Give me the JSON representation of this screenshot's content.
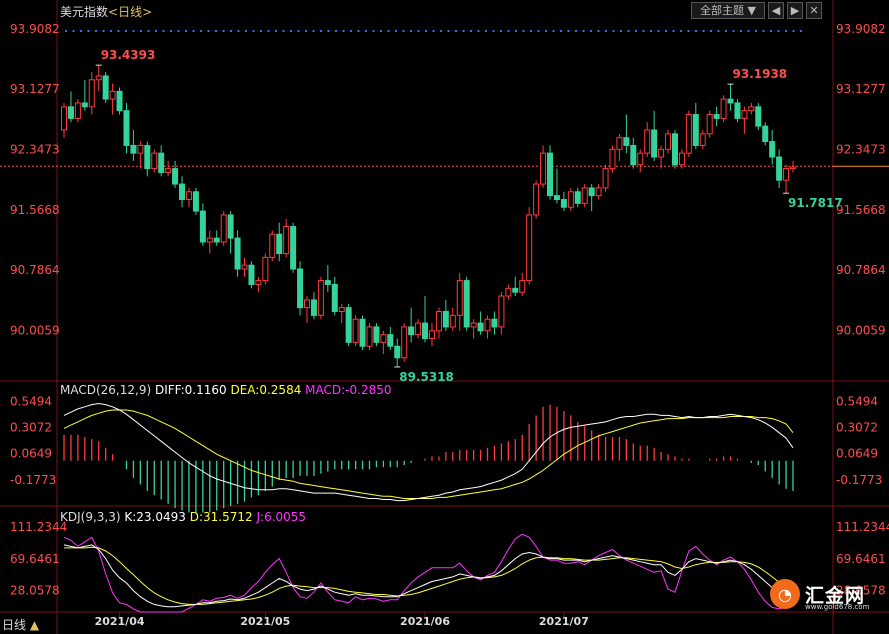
{
  "header": {
    "title": "美元指数",
    "period_label": "<日线>",
    "theme_button": "全部主题",
    "theme_arrow": "▼"
  },
  "window_controls": [
    "◀",
    "▶",
    "✕"
  ],
  "footer": {
    "tab_label": "日线",
    "tab_arrow": "▲"
  },
  "logo": {
    "text": "汇金网",
    "url": "www.gold678.com"
  },
  "colors": {
    "up": "#ff3b3b",
    "down": "#35d39c",
    "axis": "#ff4d4d",
    "dif": "#ffffff",
    "dea": "#ffff33",
    "macd_text": "#ff33ff",
    "j": "#ff33ff",
    "reference": "#ff8c1a"
  },
  "chart_data": [
    {
      "type": "candlestick",
      "title": "美元指数",
      "y_ticks": [
        "93.9082",
        "93.1277",
        "92.3473",
        "91.5668",
        "90.7864",
        "90.0059"
      ],
      "x_ticks": [
        "2021/04",
        "2021/05",
        "2021/06",
        "2021/07"
      ],
      "ylim": [
        89.35,
        94.05
      ],
      "reference_line": 92.13,
      "annotations": [
        {
          "text": "93.4393",
          "value": 93.4393,
          "color": "#ff4d4d"
        },
        {
          "text": "89.5318",
          "value": 89.5318,
          "color": "#35d39c"
        },
        {
          "text": "93.1938",
          "value": 93.1938,
          "color": "#ff4d4d"
        },
        {
          "text": "91.7817",
          "value": 91.7817,
          "color": "#35d39c"
        }
      ],
      "candles": [
        [
          92.6,
          92.95,
          92.5,
          92.9
        ],
        [
          92.9,
          93.1,
          92.7,
          92.75
        ],
        [
          92.75,
          93.0,
          92.7,
          92.95
        ],
        [
          92.95,
          93.25,
          92.85,
          92.9
        ],
        [
          92.9,
          93.35,
          92.8,
          93.25
        ],
        [
          93.25,
          93.4393,
          93.1,
          93.3
        ],
        [
          93.3,
          93.35,
          92.95,
          93.0
        ],
        [
          93.0,
          93.2,
          92.8,
          93.1
        ],
        [
          93.1,
          93.15,
          92.8,
          92.85
        ],
        [
          92.85,
          92.95,
          92.3,
          92.4
        ],
        [
          92.4,
          92.6,
          92.2,
          92.3
        ],
        [
          92.3,
          92.45,
          92.1,
          92.4
        ],
        [
          92.4,
          92.45,
          92.0,
          92.1
        ],
        [
          92.1,
          92.35,
          92.05,
          92.3
        ],
        [
          92.3,
          92.4,
          92.0,
          92.05
        ],
        [
          92.05,
          92.2,
          92.0,
          92.1
        ],
        [
          92.1,
          92.2,
          91.85,
          91.9
        ],
        [
          91.9,
          92.0,
          91.6,
          91.7
        ],
        [
          91.7,
          91.85,
          91.6,
          91.8
        ],
        [
          91.8,
          91.85,
          91.5,
          91.55
        ],
        [
          91.55,
          91.65,
          91.1,
          91.15
        ],
        [
          91.15,
          91.3,
          91.0,
          91.2
        ],
        [
          91.2,
          91.3,
          91.1,
          91.15
        ],
        [
          91.15,
          91.55,
          91.1,
          91.5
        ],
        [
          91.5,
          91.55,
          91.0,
          91.2
        ],
        [
          91.2,
          91.3,
          90.7,
          90.8
        ],
        [
          90.8,
          90.95,
          90.7,
          90.85
        ],
        [
          90.85,
          90.9,
          90.55,
          90.6
        ],
        [
          90.6,
          90.7,
          90.5,
          90.65
        ],
        [
          90.65,
          91.0,
          90.6,
          90.95
        ],
        [
          90.95,
          91.3,
          90.9,
          91.25
        ],
        [
          91.25,
          91.4,
          90.9,
          91.0
        ],
        [
          91.0,
          91.45,
          90.95,
          91.35
        ],
        [
          91.35,
          91.4,
          90.75,
          90.8
        ],
        [
          90.8,
          90.9,
          90.2,
          90.3
        ],
        [
          90.3,
          90.45,
          90.1,
          90.4
        ],
        [
          90.4,
          90.5,
          90.15,
          90.2
        ],
        [
          90.2,
          90.7,
          90.15,
          90.65
        ],
        [
          90.65,
          90.85,
          90.5,
          90.6
        ],
        [
          90.6,
          90.7,
          90.2,
          90.25
        ],
        [
          90.25,
          90.35,
          90.1,
          90.3
        ],
        [
          90.3,
          90.35,
          89.8,
          89.85
        ],
        [
          89.85,
          90.2,
          89.8,
          90.15
        ],
        [
          90.15,
          90.2,
          89.75,
          89.8
        ],
        [
          89.8,
          90.1,
          89.75,
          90.05
        ],
        [
          90.05,
          90.1,
          89.8,
          89.85
        ],
        [
          89.85,
          90.0,
          89.7,
          89.95
        ],
        [
          89.95,
          90.05,
          89.75,
          89.8
        ],
        [
          89.8,
          89.9,
          89.5318,
          89.65
        ],
        [
          89.65,
          90.1,
          89.6,
          90.05
        ],
        [
          90.05,
          90.3,
          89.85,
          89.95
        ],
        [
          89.95,
          90.15,
          89.9,
          90.1
        ],
        [
          90.1,
          90.45,
          89.85,
          89.9
        ],
        [
          89.9,
          90.1,
          89.8,
          90.0
        ],
        [
          90.0,
          90.3,
          89.9,
          90.25
        ],
        [
          90.25,
          90.4,
          90.0,
          90.05
        ],
        [
          90.05,
          90.3,
          90.0,
          90.2
        ],
        [
          90.2,
          90.75,
          90.0,
          90.65
        ],
        [
          90.65,
          90.7,
          90.0,
          90.05
        ],
        [
          90.05,
          90.15,
          89.9,
          90.1
        ],
        [
          90.1,
          90.25,
          89.95,
          90.0
        ],
        [
          90.0,
          90.2,
          89.9,
          90.15
        ],
        [
          90.15,
          90.25,
          89.95,
          90.05
        ],
        [
          90.05,
          90.5,
          89.95,
          90.45
        ],
        [
          90.45,
          90.6,
          90.4,
          90.55
        ],
        [
          90.55,
          90.7,
          90.45,
          90.5
        ],
        [
          90.5,
          90.75,
          90.45,
          90.65
        ],
        [
          90.65,
          91.6,
          90.6,
          91.5
        ],
        [
          91.5,
          91.95,
          91.45,
          91.9
        ],
        [
          91.9,
          92.4,
          91.85,
          92.3
        ],
        [
          92.3,
          92.4,
          91.7,
          91.75
        ],
        [
          91.75,
          92.1,
          91.65,
          91.7
        ],
        [
          91.7,
          91.8,
          91.55,
          91.6
        ],
        [
          91.6,
          91.85,
          91.55,
          91.8
        ],
        [
          91.8,
          91.85,
          91.6,
          91.65
        ],
        [
          91.65,
          91.9,
          91.6,
          91.85
        ],
        [
          91.85,
          91.9,
          91.55,
          91.75
        ],
        [
          91.75,
          91.9,
          91.7,
          91.85
        ],
        [
          91.85,
          92.15,
          91.8,
          92.1
        ],
        [
          92.1,
          92.4,
          92.05,
          92.35
        ],
        [
          92.35,
          92.55,
          92.2,
          92.5
        ],
        [
          92.5,
          92.8,
          92.3,
          92.4
        ],
        [
          92.4,
          92.5,
          92.1,
          92.15
        ],
        [
          92.15,
          92.35,
          92.05,
          92.3
        ],
        [
          92.3,
          92.7,
          92.25,
          92.6
        ],
        [
          92.6,
          92.85,
          92.2,
          92.25
        ],
        [
          92.25,
          92.4,
          92.1,
          92.35
        ],
        [
          92.35,
          92.6,
          92.3,
          92.55
        ],
        [
          92.55,
          92.6,
          92.1,
          92.15
        ],
        [
          92.15,
          92.35,
          92.1,
          92.3
        ],
        [
          92.3,
          92.85,
          92.25,
          92.8
        ],
        [
          92.8,
          92.95,
          92.35,
          92.4
        ],
        [
          92.4,
          92.6,
          92.35,
          92.55
        ],
        [
          92.55,
          92.85,
          92.5,
          92.8
        ],
        [
          92.8,
          92.9,
          92.65,
          92.75
        ],
        [
          92.75,
          93.05,
          92.7,
          93.0
        ],
        [
          93.0,
          93.1938,
          92.85,
          92.95
        ],
        [
          92.95,
          93.0,
          92.7,
          92.75
        ],
        [
          92.75,
          92.9,
          92.55,
          92.85
        ],
        [
          92.85,
          92.95,
          92.8,
          92.9
        ],
        [
          92.9,
          92.95,
          92.6,
          92.65
        ],
        [
          92.65,
          92.7,
          92.4,
          92.45
        ],
        [
          92.45,
          92.6,
          92.15,
          92.25
        ],
        [
          92.25,
          92.35,
          91.85,
          91.95
        ],
        [
          91.95,
          92.15,
          91.7817,
          92.1
        ],
        [
          92.1,
          92.2,
          92.05,
          92.12
        ]
      ]
    },
    {
      "type": "macd",
      "title": "MACD(26,12,9)",
      "readouts": {
        "dif": "DIFF:0.1160",
        "dea": "DEA:0.2584",
        "macd": "MACD:-0.2850"
      },
      "y_ticks": [
        "0.5494",
        "0.3072",
        "0.0649",
        "-0.1773"
      ],
      "ylim": [
        -0.42,
        0.6
      ],
      "dif": [
        0.42,
        0.45,
        0.48,
        0.5,
        0.52,
        0.53,
        0.52,
        0.5,
        0.47,
        0.43,
        0.38,
        0.33,
        0.28,
        0.23,
        0.18,
        0.13,
        0.08,
        0.03,
        -0.02,
        -0.06,
        -0.1,
        -0.14,
        -0.17,
        -0.19,
        -0.21,
        -0.23,
        -0.25,
        -0.26,
        -0.27,
        -0.27,
        -0.27,
        -0.26,
        -0.26,
        -0.27,
        -0.28,
        -0.29,
        -0.3,
        -0.3,
        -0.3,
        -0.3,
        -0.31,
        -0.32,
        -0.33,
        -0.34,
        -0.35,
        -0.35,
        -0.36,
        -0.36,
        -0.37,
        -0.37,
        -0.36,
        -0.35,
        -0.34,
        -0.33,
        -0.32,
        -0.3,
        -0.29,
        -0.27,
        -0.26,
        -0.25,
        -0.24,
        -0.22,
        -0.2,
        -0.18,
        -0.15,
        -0.12,
        -0.08,
        0.0,
        0.08,
        0.16,
        0.22,
        0.26,
        0.29,
        0.31,
        0.32,
        0.33,
        0.34,
        0.35,
        0.36,
        0.38,
        0.4,
        0.41,
        0.41,
        0.42,
        0.43,
        0.43,
        0.42,
        0.42,
        0.41,
        0.4,
        0.41,
        0.4,
        0.4,
        0.41,
        0.41,
        0.42,
        0.43,
        0.42,
        0.41,
        0.4,
        0.38,
        0.35,
        0.31,
        0.26,
        0.21,
        0.12
      ],
      "dea": [
        0.3,
        0.33,
        0.36,
        0.39,
        0.42,
        0.44,
        0.46,
        0.47,
        0.47,
        0.47,
        0.46,
        0.44,
        0.42,
        0.39,
        0.36,
        0.33,
        0.3,
        0.26,
        0.22,
        0.18,
        0.14,
        0.1,
        0.06,
        0.03,
        0.0,
        -0.03,
        -0.06,
        -0.09,
        -0.11,
        -0.13,
        -0.15,
        -0.17,
        -0.18,
        -0.19,
        -0.21,
        -0.22,
        -0.23,
        -0.24,
        -0.25,
        -0.26,
        -0.27,
        -0.28,
        -0.29,
        -0.3,
        -0.31,
        -0.32,
        -0.33,
        -0.33,
        -0.34,
        -0.35,
        -0.35,
        -0.35,
        -0.35,
        -0.35,
        -0.34,
        -0.34,
        -0.33,
        -0.32,
        -0.31,
        -0.3,
        -0.29,
        -0.28,
        -0.27,
        -0.26,
        -0.24,
        -0.22,
        -0.2,
        -0.17,
        -0.13,
        -0.09,
        -0.04,
        0.01,
        0.06,
        0.1,
        0.14,
        0.17,
        0.2,
        0.23,
        0.25,
        0.27,
        0.29,
        0.31,
        0.33,
        0.35,
        0.36,
        0.37,
        0.38,
        0.39,
        0.39,
        0.39,
        0.4,
        0.4,
        0.4,
        0.4,
        0.4,
        0.4,
        0.41,
        0.41,
        0.41,
        0.41,
        0.4,
        0.4,
        0.39,
        0.37,
        0.34,
        0.26
      ]
    },
    {
      "type": "kdj",
      "title": "KDJ(9,3,3)",
      "readouts": {
        "k": "K:23.0493",
        "d": "D:31.5712",
        "j": "J:6.0055"
      },
      "y_ticks": [
        "111.2344",
        "69.6461",
        "28.0578"
      ],
      "ylim": [
        0,
        118
      ],
      "k": [
        88,
        86,
        84,
        86,
        88,
        82,
        70,
        55,
        45,
        38,
        28,
        20,
        14,
        10,
        8,
        7,
        7,
        8,
        9,
        10,
        12,
        12,
        14,
        15,
        17,
        16,
        18,
        22,
        26,
        32,
        38,
        44,
        40,
        34,
        30,
        28,
        30,
        34,
        30,
        26,
        24,
        22,
        24,
        22,
        22,
        21,
        20,
        20,
        20,
        24,
        28,
        32,
        36,
        40,
        42,
        44,
        46,
        50,
        48,
        46,
        44,
        46,
        48,
        54,
        62,
        70,
        76,
        78,
        76,
        72,
        70,
        70,
        68,
        68,
        68,
        66,
        68,
        70,
        72,
        74,
        72,
        70,
        68,
        66,
        64,
        62,
        62,
        52,
        48,
        56,
        66,
        70,
        68,
        66,
        64,
        66,
        68,
        66,
        62,
        56,
        48,
        40,
        32,
        27,
        23
      ],
      "d": [
        84,
        84,
        84,
        84,
        85,
        84,
        80,
        74,
        66,
        57,
        49,
        40,
        32,
        25,
        20,
        16,
        13,
        11,
        10,
        10,
        10,
        11,
        12,
        13,
        14,
        15,
        16,
        17,
        19,
        22,
        26,
        31,
        34,
        35,
        34,
        33,
        32,
        32,
        32,
        31,
        29,
        27,
        26,
        25,
        24,
        23,
        23,
        22,
        21,
        22,
        23,
        25,
        28,
        31,
        34,
        37,
        40,
        43,
        45,
        46,
        45,
        45,
        46,
        48,
        52,
        57,
        63,
        68,
        71,
        72,
        71,
        71,
        70,
        70,
        69,
        68,
        68,
        68,
        69,
        70,
        71,
        71,
        70,
        69,
        68,
        67,
        66,
        63,
        59,
        57,
        59,
        62,
        64,
        65,
        65,
        65,
        66,
        66,
        65,
        63,
        59,
        53,
        46,
        39,
        33
      ],
      "j": [
        98,
        94,
        86,
        92,
        98,
        80,
        50,
        25,
        12,
        10,
        4,
        0,
        0,
        0,
        0,
        0,
        0,
        0,
        5,
        10,
        16,
        14,
        18,
        19,
        22,
        18,
        22,
        32,
        40,
        52,
        62,
        70,
        52,
        32,
        20,
        18,
        26,
        38,
        26,
        16,
        14,
        12,
        20,
        16,
        18,
        17,
        14,
        16,
        16,
        28,
        38,
        46,
        52,
        58,
        58,
        58,
        58,
        64,
        54,
        46,
        42,
        48,
        52,
        66,
        82,
        96,
        102,
        98,
        86,
        72,
        68,
        68,
        64,
        64,
        66,
        62,
        68,
        74,
        78,
        82,
        74,
        68,
        64,
        60,
        56,
        52,
        54,
        30,
        26,
        54,
        80,
        86,
        76,
        68,
        62,
        68,
        72,
        66,
        56,
        42,
        26,
        14,
        6,
        4,
        6
      ]
    }
  ]
}
